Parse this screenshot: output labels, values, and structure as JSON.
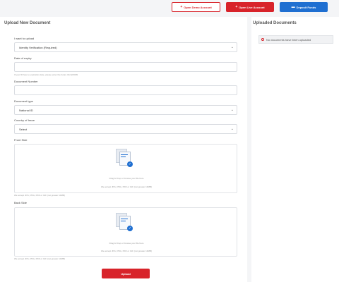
{
  "topbar": {
    "demo_label": "Open Demo Account",
    "live_label": "Open Live Account",
    "deposit_label": "Deposit Funds"
  },
  "main": {
    "title": "Upload New Document",
    "want_label": "I want to upload",
    "want_value": "Identity Verification (Required)",
    "expiry_label": "Date of expiry",
    "expiry_hint": "If your ID has no expiration date, please enter the future 31/12/2099",
    "number_label": "Document Number",
    "type_label": "Document type",
    "type_value": "National ID",
    "country_label": "Country of Issue",
    "country_value": "Select",
    "front_label": "Front Side",
    "back_label": "Back Side",
    "drop_text": "Drag & Drop or browse your file here",
    "drop_sub": "We accept JPG, PNG, PDF or GIF (not greater 10MB)",
    "accept_hint": "We accept JPG, PNG, PDF or GIF (not greater 10MB)",
    "upload_label": "Upload"
  },
  "side": {
    "title": "Uploaded Documents",
    "empty_text": "No documents have been uploaded"
  }
}
